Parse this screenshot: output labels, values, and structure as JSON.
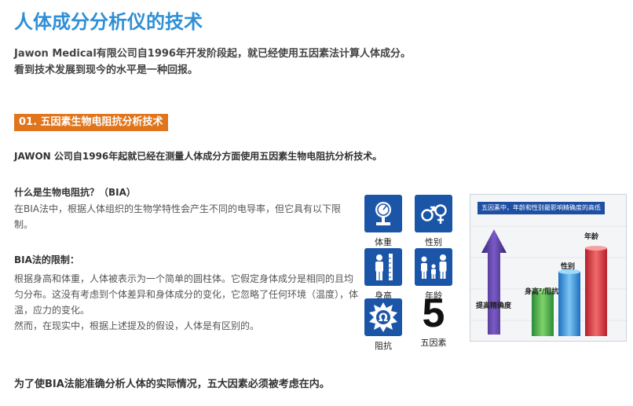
{
  "title": "人体成分分析仪的技术",
  "intro": {
    "line1": "Jawon Medical有限公司自1996年开发阶段起，就已经使用五因素法计算人体成分。",
    "line2": "看到技术发展到现今的水平是一种回报。"
  },
  "section": {
    "heading": "01. 五因素生物电阻抗分析技术"
  },
  "lead": "JAWON 公司自1996年起就已经在测量人体成分方面使用五因素生物电阻抗分析技术。",
  "bia": {
    "question": "什么是生物电阻抗？（BIA）",
    "answer": "在BIA法中，根据人体组织的生物学特性会产生不同的电导率，但它具有以下限制。"
  },
  "limits": {
    "heading": "BIA法的限制：",
    "line1": "根据身高和体重，人体被表示为一个简单的圆柱体。它假定身体成分是相同的且均匀分布。这没有考虑到个体差异和身体成分的变化，它忽略了任何环境（温度），体温，应力的变化。",
    "line2": "然而，在现实中，根据上述提及的假设，人体是有区别的。"
  },
  "factors": {
    "weight": {
      "label": "体重",
      "icon": "scale-icon"
    },
    "gender": {
      "label": "性别",
      "icon": "gender-icon"
    },
    "height": {
      "label": "身高",
      "icon": "height-icon"
    },
    "age": {
      "label": "年龄",
      "icon": "family-age-icon"
    },
    "impedance": {
      "label": "阻抗",
      "icon": "impedance-omega-icon"
    },
    "five": {
      "digit": "5",
      "label": "五因素"
    }
  },
  "graphic": {
    "banner": "五因素中，年龄和性别最影响精确度的高低",
    "arrow_label": "提高精确度",
    "bar_labels": {
      "height_weight": "身高²/阻抗",
      "gender": "性别",
      "age": "年龄"
    },
    "colors": {
      "arrow": "#5b3fa6",
      "bar1": "#3aa84a",
      "bar2": "#2f8fd8",
      "bar3": "#d8343f"
    }
  },
  "bottom": "为了使BIA法能准确分析人体的实际情况，五大因素必须被考虑在内。"
}
